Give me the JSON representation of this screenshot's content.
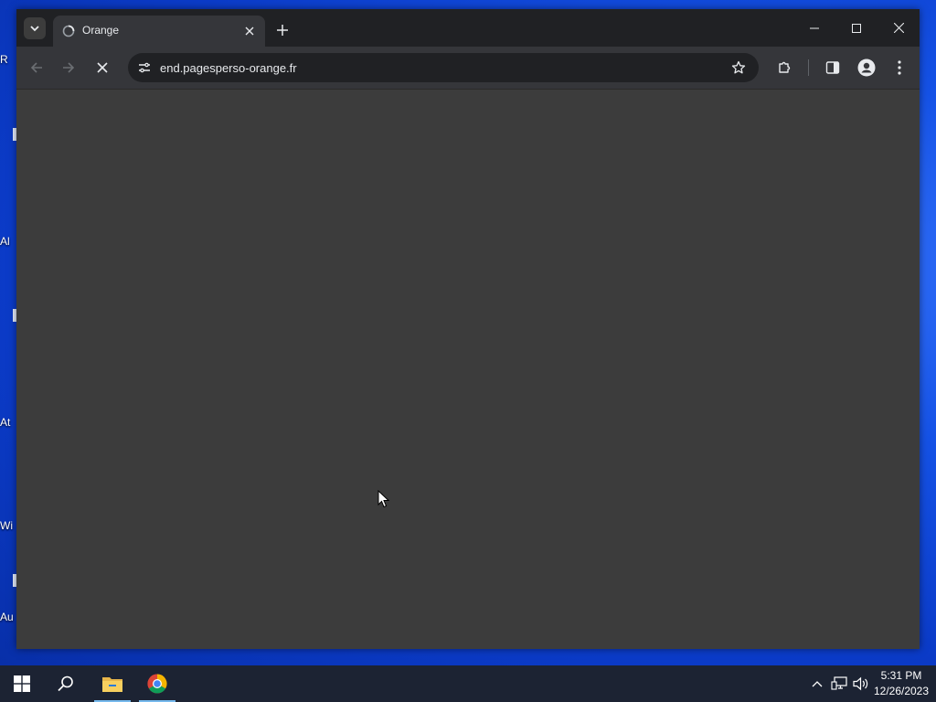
{
  "desktop": {
    "icon_labels": [
      "R",
      "Al",
      "At",
      "Wi",
      "Au"
    ]
  },
  "browser": {
    "tab": {
      "title": "Orange",
      "loading": true
    },
    "address_bar": {
      "url": "end.pagesperso-orange.fr"
    },
    "content_state": "loading"
  },
  "taskbar": {
    "apps": [
      "start-icon",
      "search-icon",
      "file-explorer-icon",
      "chrome-icon"
    ],
    "clock": {
      "time": "5:31 PM",
      "date": "12/26/2023"
    }
  },
  "colors": {
    "titlebar": "#202124",
    "toolbar": "#35363a",
    "content": "#3c3c3c",
    "desktop": "#1552e6",
    "taskbar": "#1c2333"
  }
}
